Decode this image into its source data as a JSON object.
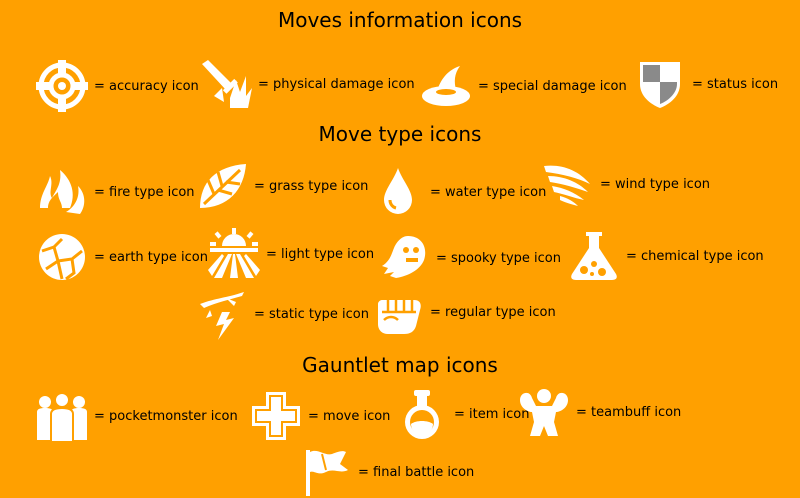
{
  "colors": {
    "background": "#FFA000",
    "icon": "#FFFFFF",
    "text": "#000000",
    "status_gray": "#8A8A8A"
  },
  "sections": {
    "moves_info": {
      "title": "Moves information icons",
      "items": [
        {
          "label": "= accuracy icon",
          "icon": "accuracy-icon"
        },
        {
          "label": "= physical damage icon",
          "icon": "physical-damage-icon"
        },
        {
          "label": "= special damage icon",
          "icon": "special-damage-icon"
        },
        {
          "label": "= status icon",
          "icon": "status-icon"
        }
      ]
    },
    "move_types": {
      "title": "Move type icons",
      "items": [
        {
          "label": "= fire type icon",
          "icon": "fire-type-icon"
        },
        {
          "label": "= grass type icon",
          "icon": "grass-type-icon"
        },
        {
          "label": "= water type icon",
          "icon": "water-type-icon"
        },
        {
          "label": "= wind type icon",
          "icon": "wind-type-icon"
        },
        {
          "label": "= earth type icon",
          "icon": "earth-type-icon"
        },
        {
          "label": "= light type icon",
          "icon": "light-type-icon"
        },
        {
          "label": "= spooky type icon",
          "icon": "spooky-type-icon"
        },
        {
          "label": "= chemical type icon",
          "icon": "chemical-type-icon"
        },
        {
          "label": "= static type icon",
          "icon": "static-type-icon"
        },
        {
          "label": "= regular type icon",
          "icon": "regular-type-icon"
        }
      ]
    },
    "gauntlet": {
      "title": "Gauntlet map icons",
      "items": [
        {
          "label": "= pocketmonster icon",
          "icon": "pocketmonster-icon"
        },
        {
          "label": "= move icon",
          "icon": "move-icon"
        },
        {
          "label": "= item icon",
          "icon": "item-icon"
        },
        {
          "label": "= teambuff icon",
          "icon": "teambuff-icon"
        },
        {
          "label": "= final battle icon",
          "icon": "final-battle-icon"
        }
      ]
    }
  }
}
